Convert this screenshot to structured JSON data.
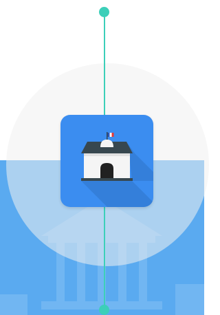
{
  "scene": {
    "icons": {
      "app": "town-hall-icon",
      "flag": "french-flag-icon"
    },
    "colors": {
      "timeline": "#3ccfb9",
      "icon_background": "#3b8df0",
      "lower_background": "#5aaaf0",
      "upper_background": "#ffffff",
      "halo": "#f0f0f0"
    }
  }
}
